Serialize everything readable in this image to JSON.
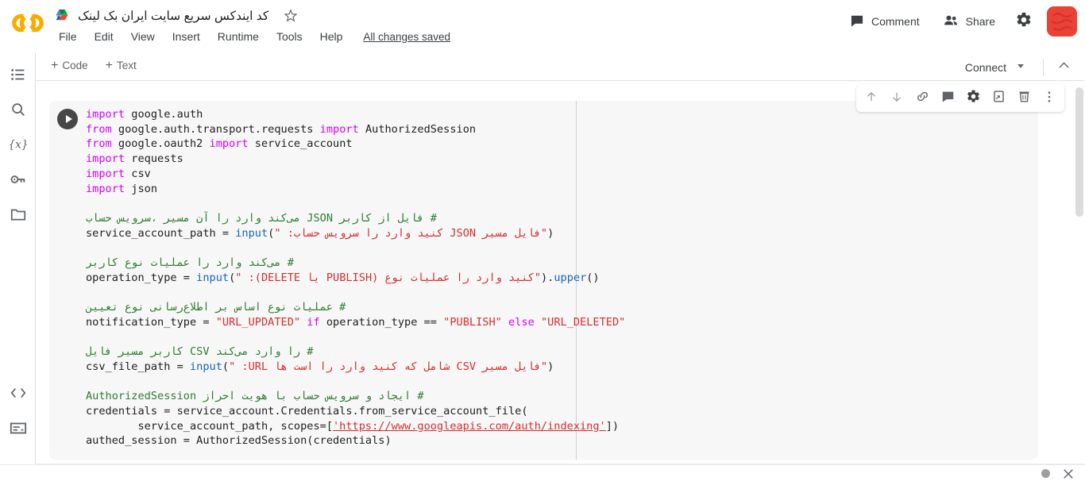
{
  "header": {
    "logo_alt": "colab-logo",
    "doc_title": "کد ایندکس سریع سایت ایران بک لینک",
    "drive_icon": "drive-icon",
    "star_icon": "star-icon",
    "menu": [
      "File",
      "Edit",
      "View",
      "Insert",
      "Runtime",
      "Tools",
      "Help"
    ],
    "saved_status": "All changes saved",
    "comment_label": "Comment",
    "share_label": "Share",
    "settings_icon": "gear-icon",
    "avatar_label": "user-avatar"
  },
  "toolbar": {
    "add_code_label": "Code",
    "add_text_label": "Text",
    "plus": "+",
    "connect_label": "Connect",
    "connect_caret": "▼",
    "collapse_caret": "︿"
  },
  "sidebar": {
    "top_items": [
      {
        "name": "table-of-contents-icon",
        "title": "Table of contents"
      },
      {
        "name": "search-icon",
        "title": "Find and replace"
      },
      {
        "name": "variables-icon",
        "title": "Variables"
      },
      {
        "name": "secrets-key-icon",
        "title": "Secrets"
      },
      {
        "name": "files-folder-icon",
        "title": "Files"
      }
    ],
    "bottom_items": [
      {
        "name": "code-snippets-icon",
        "title": "Code snippets"
      },
      {
        "name": "terminal-icon",
        "title": "Terminal"
      }
    ]
  },
  "cell_toolbar": {
    "items": [
      {
        "name": "move-cell-up-icon",
        "title": "Move cell up"
      },
      {
        "name": "move-cell-down-icon",
        "title": "Move cell down"
      },
      {
        "name": "link-to-cell-icon",
        "title": "Link to cell"
      },
      {
        "name": "add-comment-icon",
        "title": "Add comment"
      },
      {
        "name": "cell-settings-icon",
        "title": "Editor settings"
      },
      {
        "name": "mirror-cell-icon",
        "title": "Mirror cell in tab"
      },
      {
        "name": "delete-cell-icon",
        "title": "Delete cell"
      },
      {
        "name": "more-options-icon",
        "title": "More cell actions"
      }
    ]
  },
  "cell": {
    "run_button_title": "Run cell",
    "code_lines": [
      {
        "t": "import-google-auth",
        "parts": [
          {
            "c": "k",
            "s": "import"
          },
          {
            "c": "",
            "s": " google.auth"
          }
        ]
      },
      {
        "t": "from-transport-requests",
        "parts": [
          {
            "c": "k",
            "s": "from"
          },
          {
            "c": "",
            "s": " google.auth.transport.requests "
          },
          {
            "c": "k",
            "s": "import"
          },
          {
            "c": "",
            "s": " AuthorizedSession"
          }
        ]
      },
      {
        "t": "from-oauth2",
        "parts": [
          {
            "c": "k",
            "s": "from"
          },
          {
            "c": "",
            "s": " google.oauth2 "
          },
          {
            "c": "k",
            "s": "import"
          },
          {
            "c": "",
            "s": " service_account"
          }
        ]
      },
      {
        "t": "import-requests",
        "parts": [
          {
            "c": "k",
            "s": "import"
          },
          {
            "c": "",
            "s": " requests"
          }
        ]
      },
      {
        "t": "import-csv",
        "parts": [
          {
            "c": "k",
            "s": "import"
          },
          {
            "c": "",
            "s": " csv"
          }
        ]
      },
      {
        "t": "import-json",
        "parts": [
          {
            "c": "k",
            "s": "import"
          },
          {
            "c": "",
            "s": " json"
          }
        ]
      },
      {
        "t": "blank-1",
        "parts": [
          {
            "c": "",
            "s": ""
          }
        ]
      },
      {
        "t": "comment-service-account",
        "parts": [
          {
            "c": "c rtl",
            "s": "# فایل از کاربر JSON می‌کند وارد را آن مسیر ،سرویس حساب"
          }
        ]
      },
      {
        "t": "service-account-path",
        "parts": [
          {
            "c": "",
            "s": "service_account_path = "
          },
          {
            "c": "f",
            "s": "input"
          },
          {
            "c": "",
            "s": "("
          },
          {
            "c": "s rtl",
            "s": "\"فایل مسیر JSON کنید وارد را سرویس حساب: \""
          },
          {
            "c": "",
            "s": ")"
          }
        ]
      },
      {
        "t": "blank-2",
        "parts": [
          {
            "c": "",
            "s": ""
          }
        ]
      },
      {
        "t": "comment-operation-type",
        "parts": [
          {
            "c": "c rtl",
            "s": "# می‌کند وارد را عملیات نوع کاربر"
          }
        ]
      },
      {
        "t": "operation-type",
        "parts": [
          {
            "c": "",
            "s": "operation_type = "
          },
          {
            "c": "f",
            "s": "input"
          },
          {
            "c": "",
            "s": "("
          },
          {
            "c": "s rtl",
            "s": "\"کنید وارد را عملیات نوع (PUBLISH یا DELETE): \""
          },
          {
            "c": "",
            "s": ")."
          },
          {
            "c": "f",
            "s": "upper"
          },
          {
            "c": "",
            "s": "()"
          }
        ]
      },
      {
        "t": "blank-3",
        "parts": [
          {
            "c": "",
            "s": ""
          }
        ]
      },
      {
        "t": "comment-notification-type",
        "parts": [
          {
            "c": "c rtl",
            "s": "# عملیات نوع اساس بر اطلاع‌رسانی نوع تعیین"
          }
        ]
      },
      {
        "t": "notification-type",
        "parts": [
          {
            "c": "",
            "s": "notification_type = "
          },
          {
            "c": "s",
            "s": "\"URL_UPDATED\""
          },
          {
            "c": "",
            "s": " "
          },
          {
            "c": "k",
            "s": "if"
          },
          {
            "c": "",
            "s": " operation_type == "
          },
          {
            "c": "s",
            "s": "\"PUBLISH\""
          },
          {
            "c": "",
            "s": " "
          },
          {
            "c": "k",
            "s": "else"
          },
          {
            "c": "",
            "s": " "
          },
          {
            "c": "s",
            "s": "\"URL_DELETED\""
          }
        ]
      },
      {
        "t": "blank-4",
        "parts": [
          {
            "c": "",
            "s": ""
          }
        ]
      },
      {
        "t": "comment-csv-path",
        "parts": [
          {
            "c": "c rtl",
            "s": "# را وارد می‌کند CSV کاربر مسیر فایل"
          }
        ]
      },
      {
        "t": "csv-file-path",
        "parts": [
          {
            "c": "",
            "s": "csv_file_path = "
          },
          {
            "c": "f",
            "s": "input"
          },
          {
            "c": "",
            "s": "("
          },
          {
            "c": "s rtl",
            "s": "\"فایل مسیر CSV شامل که کنید وارد را است ها URL: \""
          },
          {
            "c": "",
            "s": ")"
          }
        ]
      },
      {
        "t": "blank-5",
        "parts": [
          {
            "c": "",
            "s": ""
          }
        ]
      },
      {
        "t": "comment-authorized-session",
        "parts": [
          {
            "c": "c rtl",
            "s": "# ایجاد و سرویس حساب با هویت احراز AuthorizedSession"
          }
        ]
      },
      {
        "t": "credentials",
        "parts": [
          {
            "c": "",
            "s": "credentials = service_account.Credentials.from_service_account_file("
          }
        ]
      },
      {
        "t": "scopes",
        "parts": [
          {
            "c": "",
            "s": "        service_account_path, scopes=["
          },
          {
            "c": "u",
            "s": "'https://www.googleapis.com/auth/indexing'"
          },
          {
            "c": "",
            "s": "])"
          }
        ]
      },
      {
        "t": "authed-session",
        "parts": [
          {
            "c": "",
            "s": "authed_session = AuthorizedSession(credentials)"
          }
        ]
      }
    ]
  },
  "bottom": {
    "status_indicator": "idle-status-dot",
    "close_icon": "close-icon"
  },
  "colors": {
    "accent_orange": "#F9AB00",
    "keyword": "#D500F9",
    "string": "#D32F2F",
    "comment": "#2E7D32",
    "builtin": "#1565C0",
    "cell_bg": "#F7F7F7",
    "avatar": "#EA4335"
  }
}
